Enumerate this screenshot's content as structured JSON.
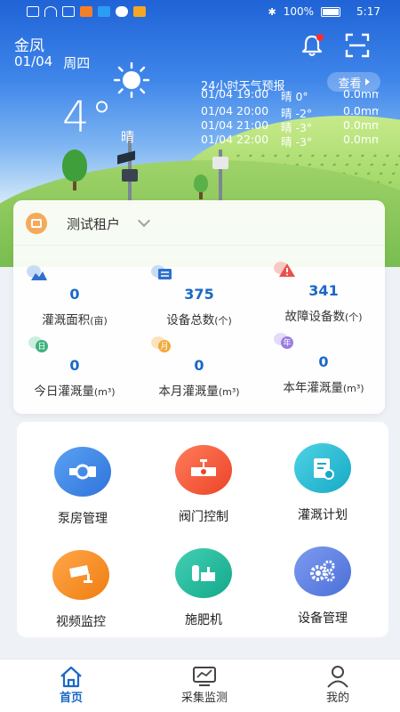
{
  "status_bar": {
    "battery": "100%",
    "time": "5:17"
  },
  "header": {
    "location": "金凤",
    "date": "01/04",
    "weekday": "周四"
  },
  "weather": {
    "temperature": "4°",
    "condition": "晴",
    "forecast_title": "24小时天气预报",
    "view_label": "查看",
    "forecast": [
      {
        "time": "01/04 19:00",
        "weather": "晴 0°",
        "precip": "0.0mm"
      },
      {
        "time": "01/04 20:00",
        "weather": "晴 -2°",
        "precip": "0.0mm"
      },
      {
        "time": "01/04 21:00",
        "weather": "晴 -3°",
        "precip": "0.0mm"
      },
      {
        "time": "01/04 22:00",
        "weather": "晴 -3°",
        "precip": "0.0mm"
      }
    ]
  },
  "tenant": {
    "name": "测试租户"
  },
  "stats": [
    {
      "value": "0",
      "label": "灌溉面积",
      "unit": "(亩)",
      "icon": "area-icon",
      "color": "#6aa6e8"
    },
    {
      "value": "375",
      "label": "设备总数",
      "unit": "(个)",
      "icon": "device-icon",
      "color": "#6aa6e8"
    },
    {
      "value": "341",
      "label": "故障设备数",
      "unit": "(个)",
      "icon": "fault-icon",
      "color": "#e8534a"
    },
    {
      "value": "0",
      "label": "今日灌溉量",
      "unit": "(m³)",
      "icon": "day-icon",
      "badge": "日",
      "color": "#3fb27f"
    },
    {
      "value": "0",
      "label": "本月灌溉量",
      "unit": "(m³)",
      "icon": "month-icon",
      "badge": "月",
      "color": "#f2a93b"
    },
    {
      "value": "0",
      "label": "本年灌溉量",
      "unit": "(m³)",
      "icon": "year-icon",
      "badge": "年",
      "color": "#9b7de0"
    }
  ],
  "functions": [
    {
      "label": "泵房管理",
      "icon": "pump-icon",
      "color": "#3d8ae8"
    },
    {
      "label": "阀门控制",
      "icon": "valve-icon",
      "color": "#f0563c"
    },
    {
      "label": "灌溉计划",
      "icon": "plan-icon",
      "color": "#25bdd4"
    },
    {
      "label": "视频监控",
      "icon": "camera-icon",
      "color": "#f58b1f"
    },
    {
      "label": "施肥机",
      "icon": "fertilizer-icon",
      "color": "#22b79c"
    },
    {
      "label": "设备管理",
      "icon": "gears-icon",
      "color": "#5b7fe0"
    }
  ],
  "nav": [
    {
      "label": "首页",
      "icon": "home-icon",
      "active": true
    },
    {
      "label": "采集监测",
      "icon": "monitor-icon",
      "active": false
    },
    {
      "label": "我的",
      "icon": "profile-icon",
      "active": false
    }
  ],
  "accent_color": "#1a68c6"
}
